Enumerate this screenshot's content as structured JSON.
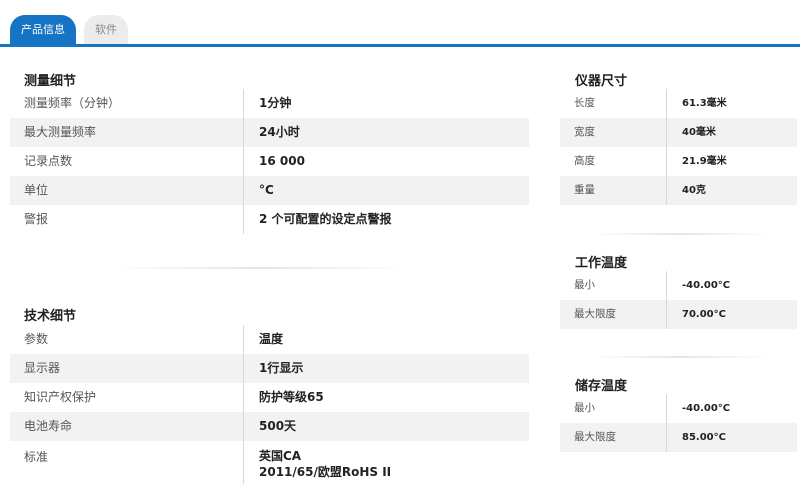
{
  "tabs": [
    {
      "label": "产品信息",
      "active": true
    },
    {
      "label": "软件",
      "active": false
    }
  ],
  "measurement": {
    "title": "测量细节",
    "rows": [
      {
        "label": "测量频率（分钟）",
        "value": "1分钟"
      },
      {
        "label": "最大测量频率",
        "value": "24小时"
      },
      {
        "label": "记录点数",
        "value": "16 000"
      },
      {
        "label": "单位",
        "value": "°C"
      },
      {
        "label": "警报",
        "value": "2 个可配置的设定点警报"
      }
    ]
  },
  "technical": {
    "title": "技术细节",
    "rows": [
      {
        "label": "参数",
        "value": "温度"
      },
      {
        "label": "显示器",
        "value": "1行显示"
      },
      {
        "label": "知识产权保护",
        "value": "防护等级65"
      },
      {
        "label": "电池寿命",
        "value": "500天"
      },
      {
        "label": "标准",
        "value": "英国CA",
        "value2": "2011/65/欧盟RoHS II"
      }
    ]
  },
  "dimensions": {
    "title": "仪器尺寸",
    "rows": [
      {
        "label": "长度",
        "value": "61.3毫米"
      },
      {
        "label": "宽度",
        "value": "40毫米"
      },
      {
        "label": "高度",
        "value": "21.9毫米"
      },
      {
        "label": "重量",
        "value": "40克"
      }
    ]
  },
  "operating_temp": {
    "title": "工作温度",
    "rows": [
      {
        "label": "最小",
        "value": "-40.00°C"
      },
      {
        "label": "最大限度",
        "value": "70.00°C"
      }
    ]
  },
  "storage_temp": {
    "title": "储存温度",
    "rows": [
      {
        "label": "最小",
        "value": "-40.00°C"
      },
      {
        "label": "最大限度",
        "value": "85.00°C"
      }
    ]
  },
  "colors": {
    "accent": "#1574c4",
    "row_shade": "#f2f2f2",
    "inactive_tab": "#ececec"
  }
}
